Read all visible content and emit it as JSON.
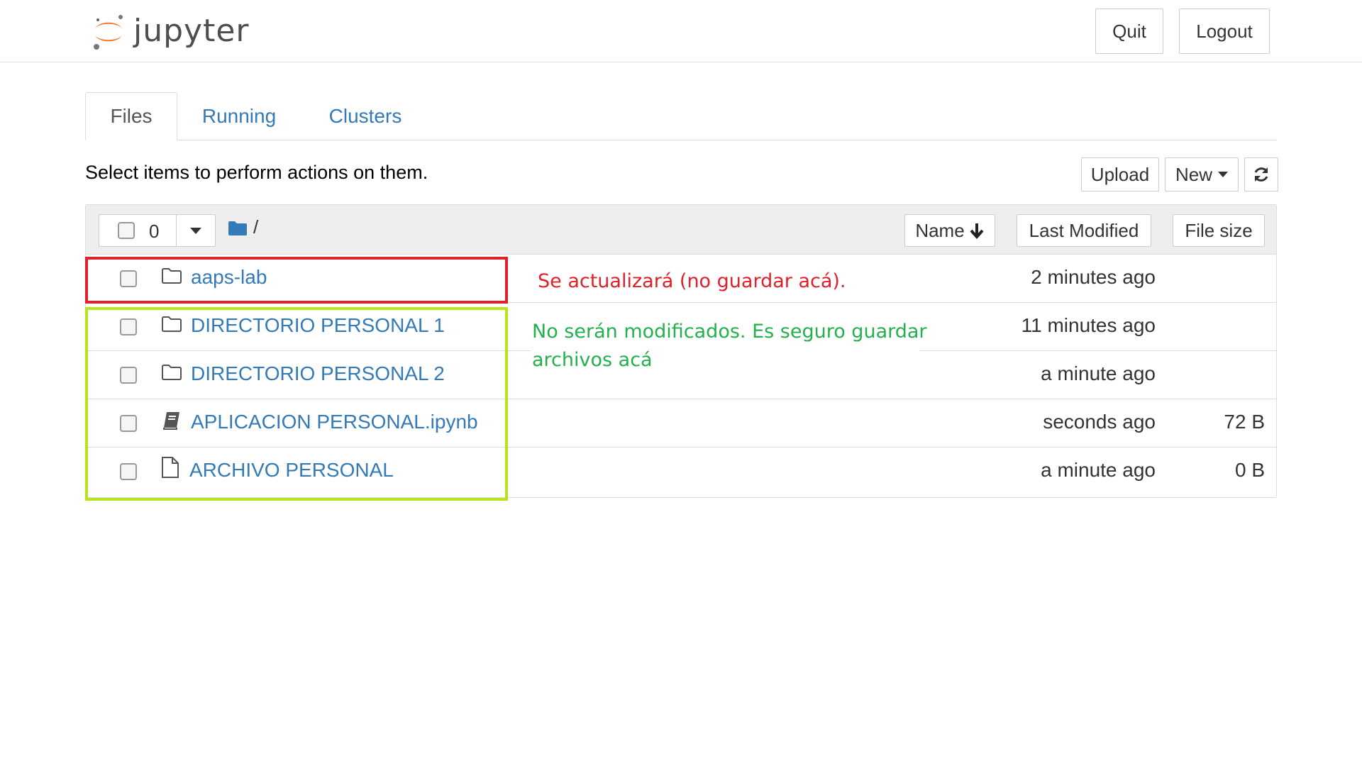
{
  "header": {
    "logo_text": "jupyter",
    "quit_label": "Quit",
    "logout_label": "Logout"
  },
  "tabs": [
    {
      "label": "Files",
      "active": true
    },
    {
      "label": "Running",
      "active": false
    },
    {
      "label": "Clusters",
      "active": false
    }
  ],
  "toolbar": {
    "hint": "Select items to perform actions on them.",
    "upload_label": "Upload",
    "new_label": "New"
  },
  "list_header": {
    "selected_count": "0",
    "path": "/",
    "sort_name_label": "Name",
    "sort_modified_label": "Last Modified",
    "sort_size_label": "File size"
  },
  "items": [
    {
      "name": "aaps-lab",
      "type": "folder",
      "modified": "2 minutes ago",
      "size": ""
    },
    {
      "name": "DIRECTORIO PERSONAL 1",
      "type": "folder",
      "modified": "11 minutes ago",
      "size": ""
    },
    {
      "name": "DIRECTORIO PERSONAL 2",
      "type": "folder",
      "modified": "a minute ago",
      "size": ""
    },
    {
      "name": "APLICACION PERSONAL.ipynb",
      "type": "notebook",
      "modified": "seconds ago",
      "size": "72 B"
    },
    {
      "name": "ARCHIVO PERSONAL",
      "type": "file",
      "modified": "a minute ago",
      "size": "0 B"
    }
  ],
  "annotations": {
    "red_text": "Se actualizará (no guardar acá).",
    "green_text_line1": "No serán modificados. Es seguro guardar",
    "green_text_line2": "archivos acá",
    "red_color": "#e0202a",
    "green_color": "#b5e61d",
    "green_text_color": "#22b14c"
  },
  "colors": {
    "link": "#337ab7",
    "logo_orange": "#f37726"
  }
}
